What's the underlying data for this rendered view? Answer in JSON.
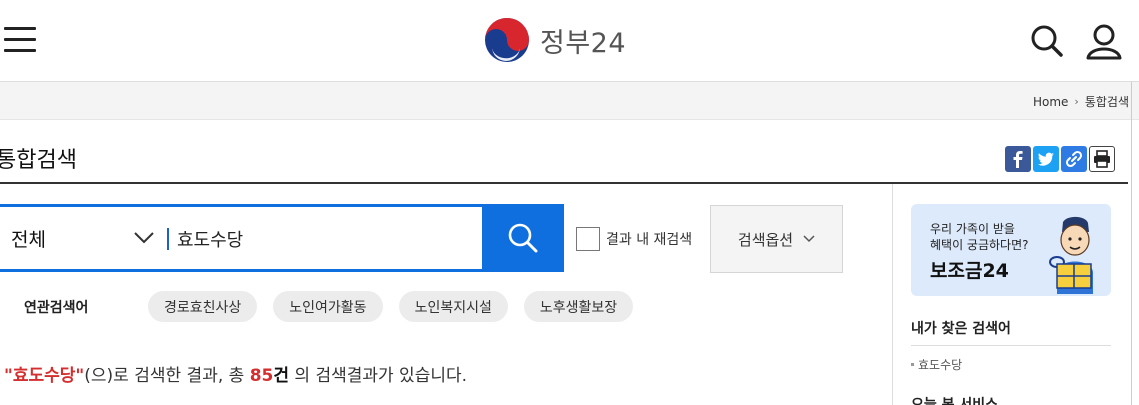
{
  "header": {
    "logo_text": "정부24"
  },
  "breadcrumb": {
    "home": "Home",
    "separator": "›",
    "current": "통합검색"
  },
  "page": {
    "title": "통합검색"
  },
  "search": {
    "category": "전체",
    "query": "효도수당",
    "re_search_label": "결과 내 재검색",
    "options_label": "검색옵션"
  },
  "related": {
    "label": "연관검색어",
    "keywords": [
      "경로효친사상",
      "노인여가활동",
      "노인복지시설",
      "노후생활보장"
    ]
  },
  "result": {
    "quote_open": "\"",
    "keyword": "효도수당",
    "quote_close": "\"",
    "text_before_count": "(으)로 검색한 결과, 총 ",
    "count": "85",
    "count_unit": "건",
    "text_after": " 의 검색결과가 있습니다."
  },
  "sidebar": {
    "banner_line1": "우리 가족이 받을",
    "banner_line2": "혜택이 궁금하다면?",
    "banner_title": "보조금24",
    "recent_title": "내가 찾은 검색어",
    "recent_items": [
      "효도수당"
    ],
    "next_heading": "오늘 본 서비스"
  },
  "colors": {
    "accent": "#0f6fde",
    "highlight": "#d42e2e",
    "facebook": "#3b5998",
    "twitter": "#1da1f2",
    "link": "#2d7be3"
  },
  "icons": [
    "menu-icon",
    "search-icon",
    "user-icon",
    "chevron-down-icon",
    "facebook-icon",
    "twitter-icon",
    "link-icon",
    "print-icon"
  ]
}
